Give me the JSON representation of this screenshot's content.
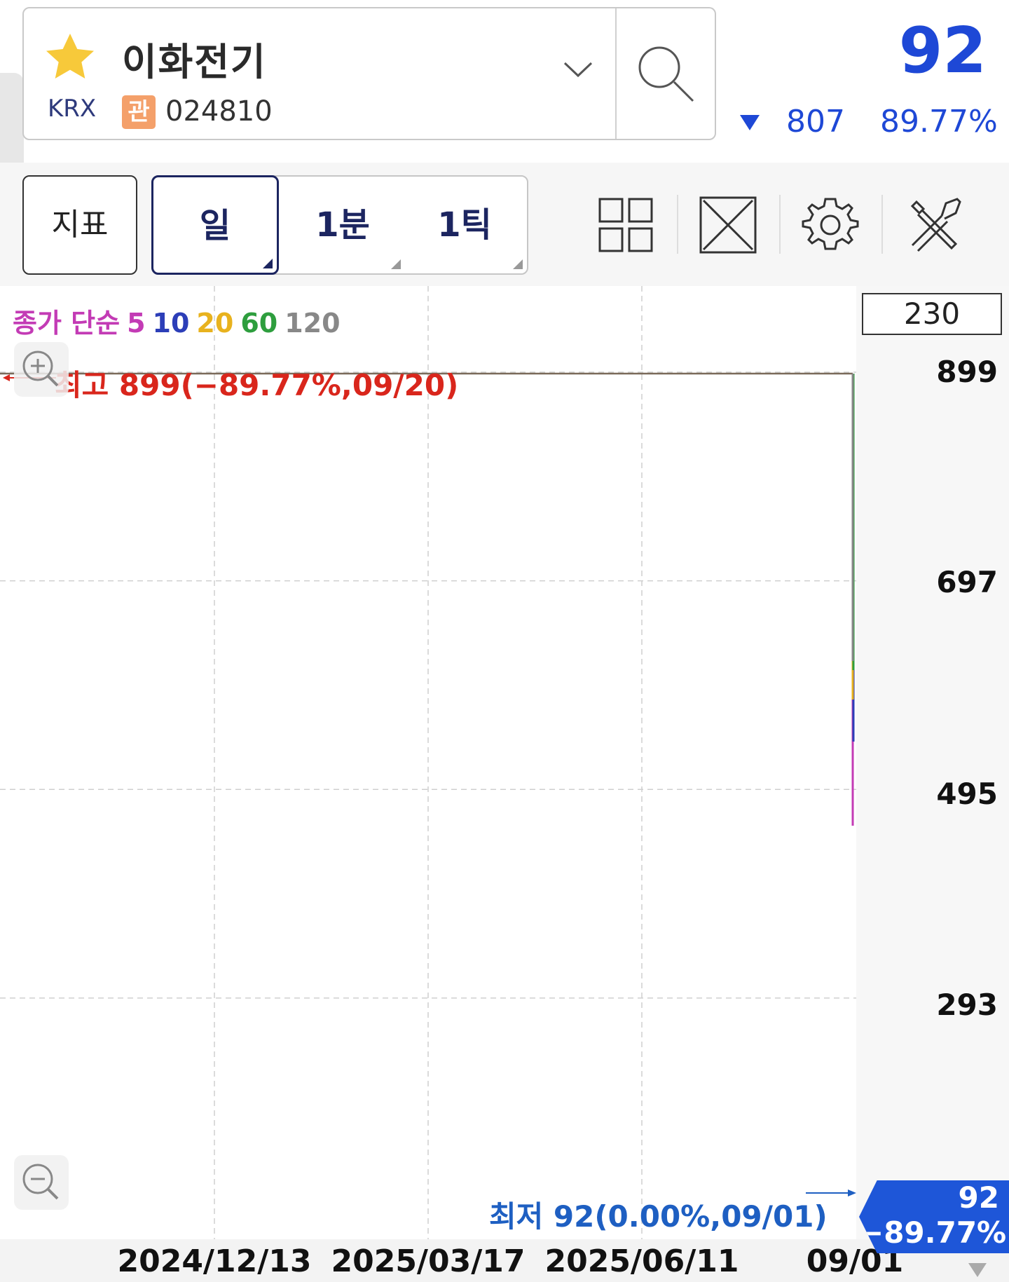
{
  "header": {
    "stock_name": "이화전기",
    "market": "KRX",
    "badge": "관",
    "code": "024810",
    "price": "92",
    "change": "807",
    "change_rate": "89.77%",
    "price_color": "#1e48d6",
    "star_color": "#f7c93a"
  },
  "toolbar": {
    "indicator_label": "지표",
    "periods": [
      {
        "label": "일",
        "active": true
      },
      {
        "label": "1분",
        "active": false
      },
      {
        "label": "1틱",
        "active": false
      }
    ],
    "icons": [
      "layout-grid-icon",
      "fullscreen-icon",
      "settings-gear-icon",
      "tools-icon"
    ]
  },
  "chart": {
    "legend": [
      {
        "text": "종가 단순",
        "color": "#c33bb5"
      },
      {
        "text": "5",
        "color": "#c33bb5"
      },
      {
        "text": "10",
        "color": "#2c3eb8"
      },
      {
        "text": "20",
        "color": "#e8b21e"
      },
      {
        "text": "60",
        "color": "#2e9e3e"
      },
      {
        "text": "120",
        "color": "#888888"
      }
    ],
    "top_value": "230",
    "high_annotation": "최고 899(−89.77%,09/20)",
    "low_annotation": "최저 92(0.00%,09/01)",
    "current_tag": {
      "price": "92",
      "rate": "−89.77%"
    }
  },
  "chart_data": {
    "type": "line",
    "x_ticks": [
      "2024/12/13",
      "2025/03/17",
      "2025/06/11",
      "09/01"
    ],
    "y_ticks": [
      "899",
      "697",
      "495",
      "293"
    ],
    "ylim": [
      92,
      899
    ],
    "grid": true,
    "series": [
      {
        "name": "5",
        "color": "#c33bb5"
      },
      {
        "name": "10",
        "color": "#2c3eb8"
      },
      {
        "name": "20",
        "color": "#e8b21e"
      },
      {
        "name": "60",
        "color": "#2e9e3e"
      },
      {
        "name": "120",
        "color": "#888888"
      }
    ]
  }
}
